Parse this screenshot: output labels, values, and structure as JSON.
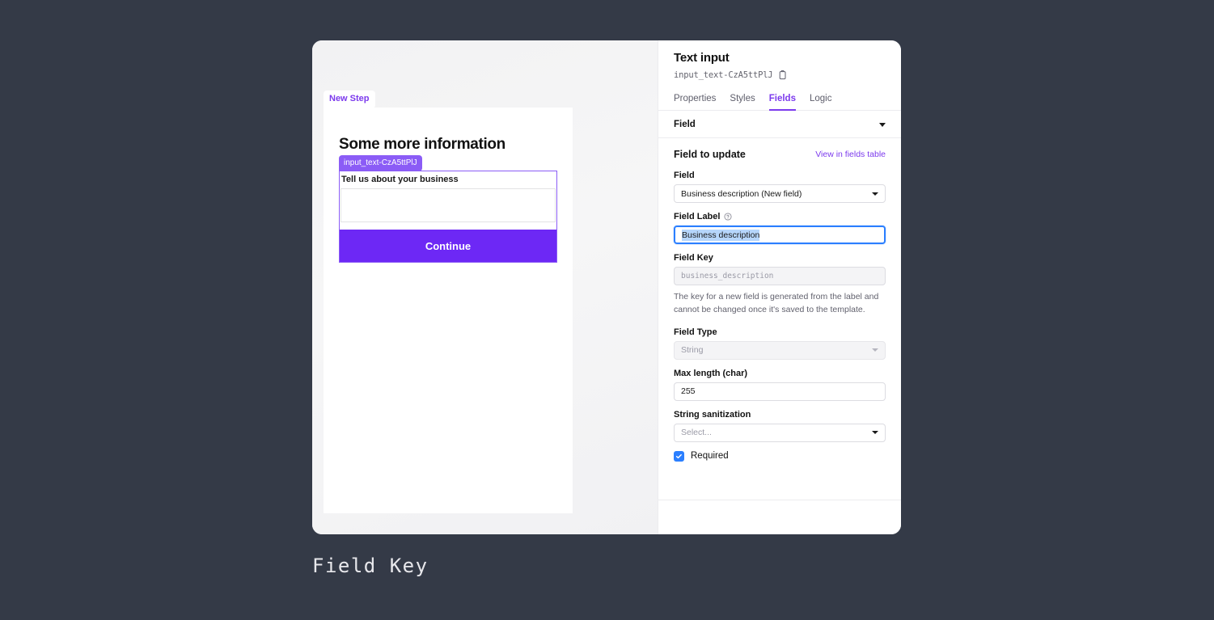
{
  "canvas": {
    "step_badge": "New Step",
    "step_title": "Some more information",
    "element_badge": "input_text-CzA5ttPlJ",
    "preview_field_label": "Tell us about your business",
    "preview_input_value": "",
    "continue_label": "Continue"
  },
  "inspector": {
    "title": "Text input",
    "element_id": "input_text-CzA5ttPlJ",
    "copy_icon": "clipboard-icon",
    "tabs": [
      {
        "label": "Properties",
        "active": false
      },
      {
        "label": "Styles",
        "active": false
      },
      {
        "label": "Fields",
        "active": true
      },
      {
        "label": "Logic",
        "active": false
      }
    ],
    "section": {
      "title": "Field",
      "caret_icon": "chevron-down-icon"
    },
    "field_to_update": {
      "heading": "Field to update",
      "link": "View in fields table"
    },
    "fields": {
      "field": {
        "label": "Field",
        "value": "Business description (New field)",
        "caret_icon": "chevron-down-icon"
      },
      "field_label": {
        "label": "Field Label",
        "help_icon": "help-circle-icon",
        "value": "Business description"
      },
      "field_key": {
        "label": "Field Key",
        "value": "business_description",
        "helper": "The key for a new field is generated from the label and cannot be changed once it's saved to the template."
      },
      "field_type": {
        "label": "Field Type",
        "value": "String",
        "caret_icon": "chevron-down-icon"
      },
      "max_length": {
        "label": "Max length (char)",
        "value": "255"
      },
      "string_sanitization": {
        "label": "String sanitization",
        "placeholder": "Select...",
        "value": "",
        "caret_icon": "chevron-down-icon"
      },
      "required": {
        "label": "Required",
        "checked": true,
        "check_icon": "checkmark-icon"
      }
    }
  },
  "caption": "Field Key",
  "colors": {
    "background": "#343a47",
    "accent_purple": "#7c3aed",
    "button_purple": "#6d28f5",
    "focus_blue": "#2b7fff",
    "selection_blue": "#b6d6fb"
  }
}
